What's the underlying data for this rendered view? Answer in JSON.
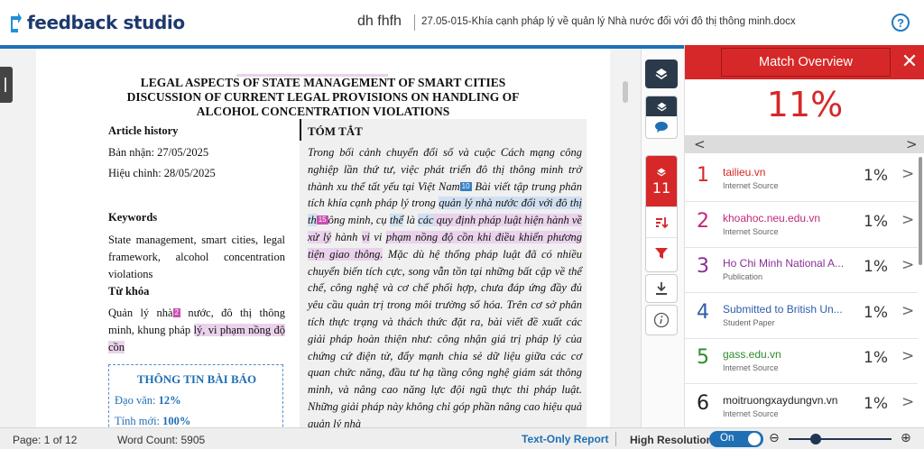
{
  "header": {
    "logo_text": "feedback studio",
    "author": "dh fhfh",
    "document_name": "27.05-015-Khía cạnh pháp lý về quản lý Nhà nước đối với đô thị thông minh.docx",
    "help_glyph": "?"
  },
  "document": {
    "title_line1": "LEGAL ASPECTS OF STATE MANAGEMENT OF SMART CITIES",
    "title_line2": "DISCUSSION OF CURRENT LEGAL PROVISIONS ON HANDLING OF",
    "title_line3": "ALCOHOL CONCENTRATION VIOLATIONS",
    "article_history_label": "Article history",
    "received": "Bản nhận: 27/05/2025",
    "revised": "Hiệu chỉnh: 28/05/2025",
    "keywords_label": "Keywords",
    "keywords_text": "State management, smart cities, legal framework, alcohol concentration violations",
    "tu_khoa_label": "Từ khóa",
    "tu_khoa_pre": "Quản lý nhà",
    "tu_khoa_tag": "2",
    "tu_khoa_mid": " nước, đô thị thông minh, khung pháp ",
    "tu_khoa_hl": "lý, vi phạm nồng độ cồn",
    "abstract_title": "TÓM TẮT",
    "abstract": {
      "p1": "Trong bối cảnh chuyển đổi số và cuộc Cách mạng công nghiệp lần thứ tư, việc phát triển đô thị thông minh trở thành xu thế tất yếu tại Việt Nam",
      "tag1": "10",
      "p2": " Bài viết tập trung phân tích khía cạnh pháp lý trong ",
      "hl1": "quản lý nhà nước đối với đô thị th",
      "tag2": "15",
      "p3": "ông minh, cụ ",
      "hl2": "thể",
      "p4": " là ",
      "hl3": "các",
      "hl4": " quy định pháp luật hiện hành ",
      "hl5": "về xử lý",
      "p5": " hành ",
      "hl6": "vi",
      "p6": " vi ",
      "hl7": "phạm nồng độ cồn khi điều khiển phương tiện giao thông.",
      "p7": " Mặc dù hệ thống pháp luật đã có nhiều chuyển biến tích cực, song vẫn tồn tại những bất cập về thể chế, công nghệ và cơ chế phối hợp, chưa đáp ứng đầy đủ yêu cầu quản trị trong môi trường số hóa. Trên cơ sở phân tích thực trạng và thách thức đặt ra, bài viết đề xuất các giải pháp hoàn thiện như: công nhận giá trị pháp lý của chứng cứ điện tử, đẩy mạnh chia sẻ dữ liệu giữa các cơ quan chức năng, đầu tư hạ tầng công nghệ giám sát thông minh, và nâng cao năng lực đội ngũ thực thi pháp luật. Những giải pháp này không chỉ góp phần nâng cao hiệu quả quản lý nhà"
    },
    "info_title": "THÔNG TIN BÀI BÁO",
    "info_line1_label": "Đạo văn: ",
    "info_line1_value": "12%",
    "info_line2_label": "Tính mới: ",
    "info_line2_value": "100%"
  },
  "toolbar": {
    "match_count": "11"
  },
  "panel": {
    "title": "Match Overview",
    "close_glyph": "✕",
    "overall_similarity": "11%",
    "nav_prev": "<",
    "nav_next": ">",
    "matches": [
      {
        "rank": "1",
        "source": "tailieu.vn",
        "type": "Internet Source",
        "percent": "1%",
        "color": "#d62828"
      },
      {
        "rank": "2",
        "source": "khoahoc.neu.edu.vn",
        "type": "Internet Source",
        "percent": "1%",
        "color": "#c2287a"
      },
      {
        "rank": "3",
        "source": "Ho Chi Minh National A...",
        "type": "Publication",
        "percent": "1%",
        "color": "#8a2f9a"
      },
      {
        "rank": "4",
        "source": "Submitted to British Un...",
        "type": "Student Paper",
        "percent": "1%",
        "color": "#2f5da8"
      },
      {
        "rank": "5",
        "source": "gass.edu.vn",
        "type": "Internet Source",
        "percent": "1%",
        "color": "#2e8b2e"
      },
      {
        "rank": "6",
        "source": "moitruongxaydungvn.vn",
        "type": "Internet Source",
        "percent": "1%",
        "color": "#222222"
      }
    ]
  },
  "statusbar": {
    "page": "Page: 1 of 12",
    "word_count": "Word Count: 5905",
    "text_only": "Text-Only Report",
    "high_res_label": "High Resolution",
    "high_res_state": "On",
    "zoom_out": "⊖",
    "zoom_in": "⊕"
  },
  "colors": {
    "brand_blue": "#1f6fb5",
    "accent_red": "#d62828",
    "toolbar_dark": "#2b3a4a"
  },
  "icons": [
    "layers-icon",
    "comment-icon",
    "filter-sort-icon",
    "filter-icon",
    "download-icon",
    "info-icon",
    "help-icon",
    "close-icon",
    "zoom-out-icon",
    "zoom-in-icon"
  ]
}
